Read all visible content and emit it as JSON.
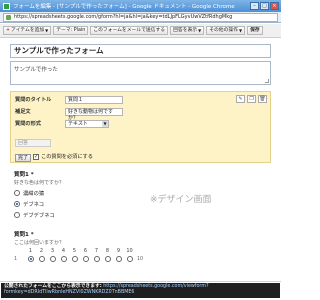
{
  "window": {
    "title": "フォームを編集 - [サンプルで作ったフォーム] - Google ドキュメント - Google Chrome",
    "buttons": [
      "–",
      "□",
      "×"
    ]
  },
  "address": {
    "url": "https://spreadsheets.google.com/gform?hl=ja&hl=ja&key=tdLJpFLGyvUwVZtfRdhgMkg"
  },
  "toolbar": {
    "add_item": "アイテムを追加",
    "theme": "テーマ: Plain",
    "email_form": "このフォームをメールで送信する",
    "see_responses": "回答を表示",
    "more_actions": "その他の操作",
    "save": "保存"
  },
  "form": {
    "title": "サンプルで作ったフォーム",
    "description": "サンプルで作った"
  },
  "edit_panel": {
    "question_title_label": "質問のタイトル",
    "question_title_value": "質問１",
    "help_label": "補足文",
    "help_value": "好きな動物は何ですか？",
    "type_label": "質問の形式",
    "type_value": "テキスト",
    "answer_placeholder": "回答",
    "done_label": "完了",
    "required_label": "この質問を必須にする",
    "icons": [
      "edit-icon",
      "duplicate-icon",
      "delete-icon"
    ]
  },
  "question1": {
    "title": "質問1 *",
    "help": "好きな色は何ですか？",
    "options": [
      {
        "label": "濃紺の猿",
        "selected": false
      },
      {
        "label": "デブネコ",
        "selected": true
      },
      {
        "label": "デブデブネコ",
        "selected": false
      }
    ]
  },
  "design_note": "※デザイン画面",
  "question2": {
    "title": "質問1 *",
    "help": "ここは何回いますか？",
    "scale": [
      "1",
      "2",
      "3",
      "4",
      "5",
      "6",
      "7",
      "8",
      "9",
      "10"
    ],
    "selected_index": 0,
    "left_label": "1",
    "right_label": "10"
  },
  "status": {
    "message": "公開されたフォームをここから表示できます:",
    "link": "https://spreadsheets.google.com/viewform?formkey=dDRIdTllwRbnIeHNZVl0ZWNKRDZ0TnBBME6"
  }
}
